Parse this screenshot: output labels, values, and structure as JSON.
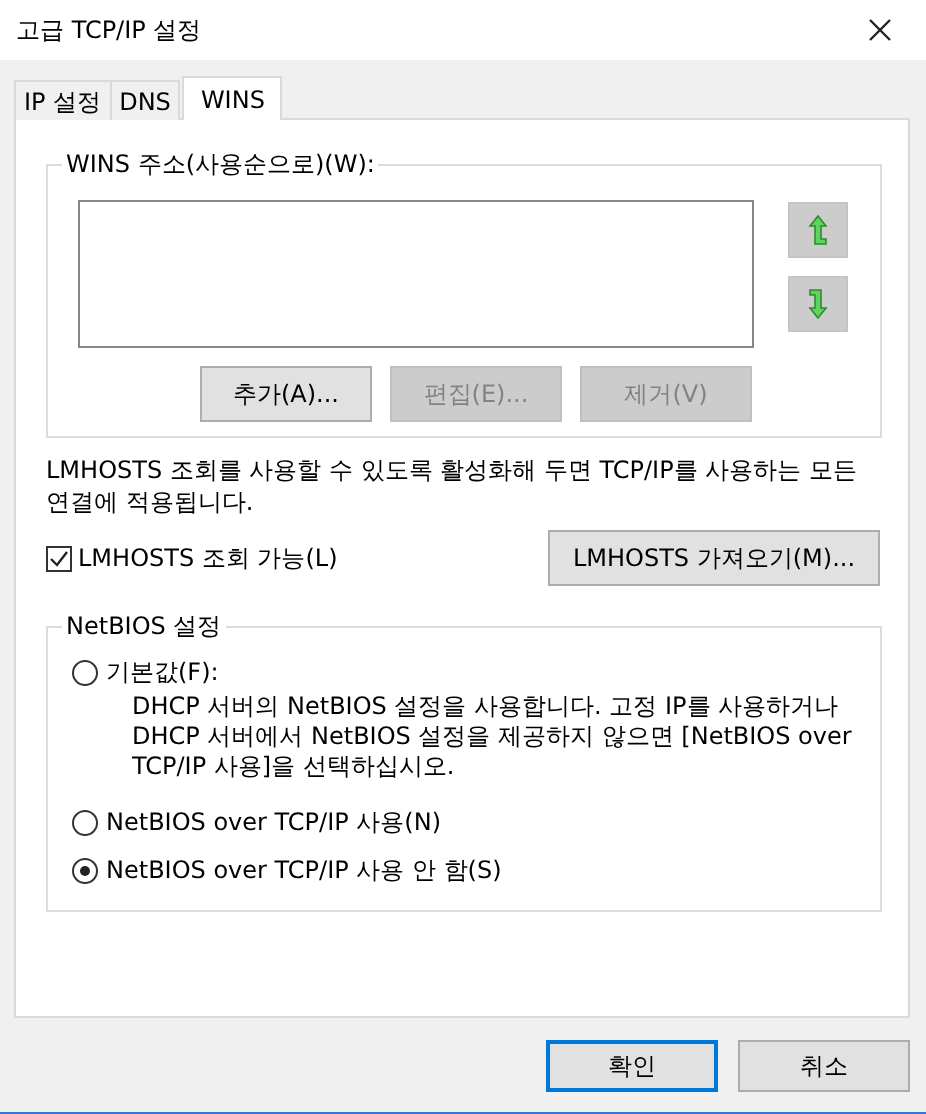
{
  "window": {
    "title": "고급 TCP/IP 설정"
  },
  "tabs": [
    {
      "label": "IP 설정",
      "selected": false
    },
    {
      "label": "DNS",
      "selected": false
    },
    {
      "label": "WINS",
      "selected": true
    }
  ],
  "wins_group": {
    "title": "WINS 주소(사용순으로)(W):",
    "buttons": [
      {
        "label": "추가(A)...",
        "disabled": false
      },
      {
        "label": "편집(E)...",
        "disabled": true
      },
      {
        "label": "제거(V)",
        "disabled": true
      }
    ]
  },
  "lmhosts_note": "LMHOSTS 조회를 사용할 수 있도록 활성화해 두면 TCP/IP를 사용하는 모든 연결에 적용됩니다.",
  "lmhosts_checkbox": {
    "label": "LMHOSTS 조회 가능(L)",
    "checked": true
  },
  "lmhosts_import_button": "LMHOSTS 가져오기(M)...",
  "netbios_group": {
    "title": "NetBIOS 설정",
    "options": [
      {
        "label": "기본값(F):",
        "selected": false,
        "description": "DHCP 서버의 NetBIOS 설정을 사용합니다. 고정 IP를 사용하거나 DHCP 서버에서 NetBIOS 설정을 제공하지 않으면 [NetBIOS over TCP/IP 사용]을 선택하십시오."
      },
      {
        "label": "NetBIOS over TCP/IP 사용(N)",
        "selected": false
      },
      {
        "label": "NetBIOS over TCP/IP 사용 안 함(S)",
        "selected": true
      }
    ]
  },
  "footer_buttons": [
    {
      "label": "확인",
      "default": true
    },
    {
      "label": "취소",
      "default": false
    }
  ]
}
